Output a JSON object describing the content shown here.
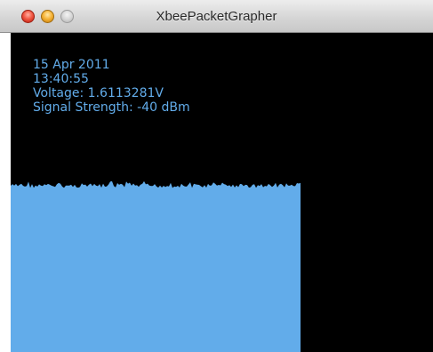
{
  "window": {
    "title": "XbeePacketGrapher"
  },
  "readout": {
    "date": "15 Apr 2011",
    "time": "13:40:55",
    "voltage": "Voltage: 1.6113281V",
    "signal_strength": "Signal Strength: -40 dBm"
  },
  "graph": {
    "fill_color": "#62acea",
    "background_color": "#000000",
    "samples_filled_fraction": 0.686,
    "level_fraction": 0.52
  }
}
